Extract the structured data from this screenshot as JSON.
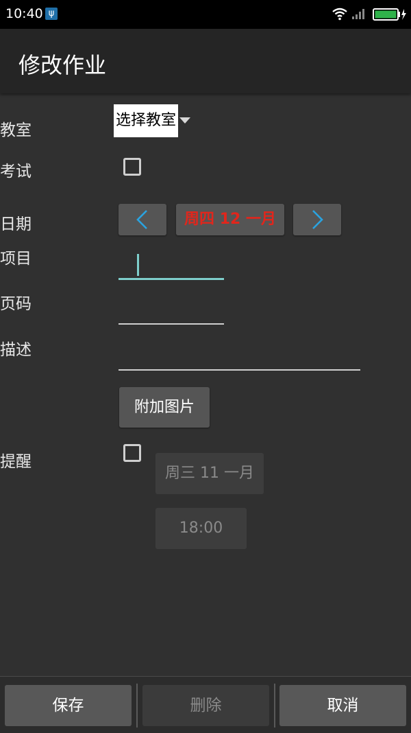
{
  "status_bar": {
    "time": "10:40",
    "usb_icon": "usb-icon",
    "wifi_icon": "wifi-icon",
    "signal_icon": "signal-icon",
    "battery_icon": "battery-charging-icon"
  },
  "app_bar": {
    "title": "修改作业"
  },
  "form": {
    "classroom_label": "教室",
    "classroom_value": "选择教室",
    "exam_label": "考试",
    "exam_checked": false,
    "date_label": "日期",
    "date_value": "周四 12 一月",
    "item_label": "项目",
    "item_value": "",
    "page_label": "页码",
    "page_value": "",
    "description_label": "描述",
    "description_value": "",
    "attach_image_button": "附加图片",
    "reminder_label": "提醒",
    "reminder_checked": false,
    "reminder_date": "周三 11 一月",
    "reminder_time": "18:00"
  },
  "bottom_bar": {
    "save": "保存",
    "delete": "删除",
    "cancel": "取消"
  },
  "colors": {
    "background": "#303030",
    "accent_cursor": "#7ecfcc",
    "date_text": "#e1261c",
    "arrow": "#2aa3e0"
  }
}
